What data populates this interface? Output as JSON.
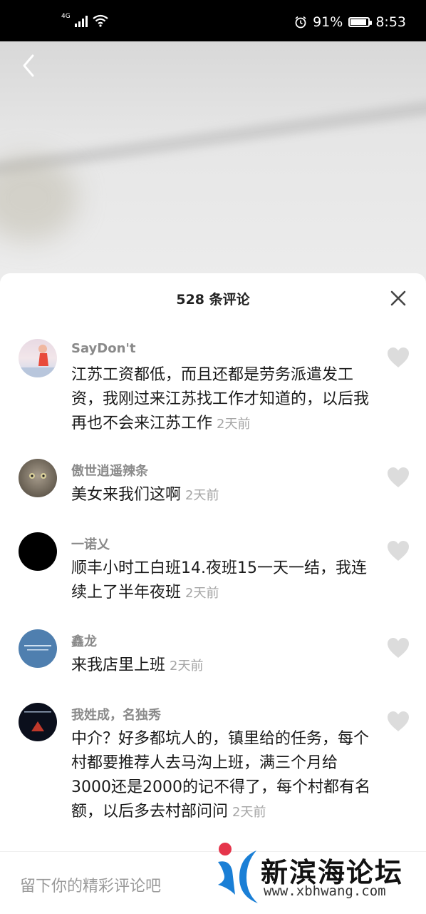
{
  "status_bar": {
    "network": "4G",
    "battery": "91%",
    "battery_level": 0.91,
    "time": "8:53"
  },
  "sheet": {
    "title": "528 条评论"
  },
  "comments": [
    {
      "username": "SayDon't",
      "text": "江苏工资都低，而且还都是劳务派遣发工资，我刚过来江苏找工作才知道的，以后我再也不会来江苏工作",
      "time": "2天前"
    },
    {
      "username": "傲世逍遥辣条",
      "text": "美女来我们这啊",
      "time": "2天前"
    },
    {
      "username": "一诺乂",
      "text": "顺丰小时工白班14.夜班15一天一结，我连续上了半年夜班",
      "time": "2天前"
    },
    {
      "username": "鑫龙",
      "text": "来我店里上班",
      "time": "2天前"
    },
    {
      "username": "我姓成，名独秀",
      "text": "中介？好多都坑人的，镇里给的任务，每个村都要推荐人去马沟上班，满三个月给3000还是2000的记不得了，每个村都有名额，以后多去村部问问",
      "time": "2天前"
    }
  ],
  "input": {
    "placeholder": "留下你的精彩评论吧"
  },
  "watermark": {
    "title": "新滨海论坛",
    "url": "www.xbhwang.com"
  },
  "colors": {
    "sheet_bg": "#ffffff",
    "username": "#8a8a8a",
    "comment_text": "#1a1a1a",
    "time": "#a5a5a5",
    "watermark_red": "#e5354b",
    "watermark_blue": "#1a7fd6"
  }
}
